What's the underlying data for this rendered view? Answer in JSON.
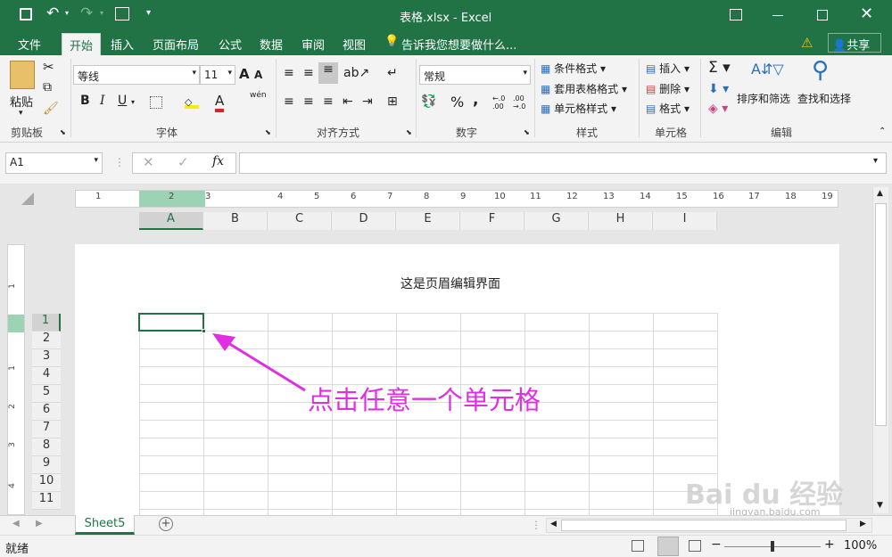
{
  "window": {
    "title": "表格.xlsx - Excel"
  },
  "tabs": [
    "文件",
    "开始",
    "插入",
    "页面布局",
    "公式",
    "数据",
    "审阅",
    "视图"
  ],
  "tell_me": "告诉我您想要做什么...",
  "share": "共享",
  "ribbon": {
    "paste": "粘贴",
    "font_name": "等线",
    "font_size": "11",
    "bold": "B",
    "italic": "I",
    "underline": "U",
    "font_color_A": "A",
    "grow_font": "A",
    "shrink_font": "A",
    "phonetic": "wén",
    "number_format": "常规",
    "percent": "%",
    "comma": ",",
    "cond_format": "条件格式",
    "table_format": "套用表格格式",
    "cell_style": "单元格样式",
    "insert": "插入",
    "delete": "删除",
    "format": "格式",
    "sort_filter": "排序和筛选",
    "find_select": "查找和选择",
    "groups": [
      "剪贴板",
      "字体",
      "对齐方式",
      "数字",
      "样式",
      "单元格",
      "编辑"
    ]
  },
  "formula_bar": {
    "name_box": "A1",
    "fx": "fx",
    "content": ""
  },
  "ruler": [
    "1",
    "1",
    "2",
    "3",
    "4",
    "5",
    "6",
    "7",
    "8",
    "9",
    "10",
    "11",
    "12",
    "13",
    "14",
    "15",
    "16",
    "17",
    "18",
    "19"
  ],
  "columns": [
    "A",
    "B",
    "C",
    "D",
    "E",
    "F",
    "G",
    "H",
    "I"
  ],
  "rows": [
    "1",
    "2",
    "3",
    "4",
    "5",
    "6",
    "7",
    "8",
    "9",
    "10",
    "11"
  ],
  "vruler": [
    "1",
    "1",
    "2",
    "3",
    "4"
  ],
  "header_text": "这是页眉编辑界面",
  "annotation": "点击任意一个单元格",
  "sheet_tab": "Sheet5",
  "status": "就绪",
  "zoom": "100%",
  "watermark": {
    "brand": "Bai du 经验",
    "url": "jingyan.baidu.com"
  },
  "colors": {
    "excel_green": "#217346",
    "annotation": "#e02fe0"
  }
}
